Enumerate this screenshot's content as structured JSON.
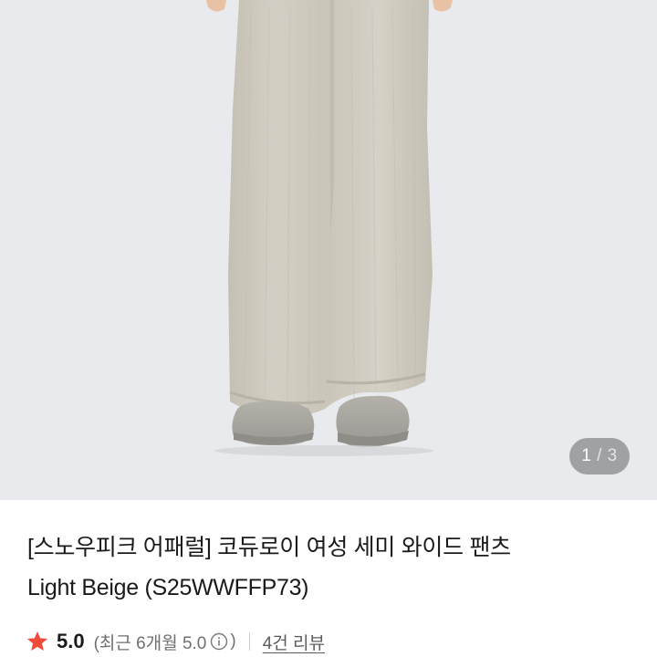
{
  "gallery": {
    "current": "1",
    "separator": "/",
    "total": "3"
  },
  "product": {
    "title_line1": "[스노우피크 어패럴] 코듀로이 여성 세미 와이드 팬츠",
    "title_line2": "Light Beige (S25WWFFP73)"
  },
  "rating": {
    "score": "5.0",
    "recent_open": "(최근 6개월 5.0",
    "recent_close": ")",
    "review_count": "4건 리뷰"
  },
  "icons": {
    "star": "star-icon",
    "info": "info-circle-icon"
  },
  "colors": {
    "star": "#f04a3a",
    "background_photo": "#e8eaed",
    "pants": "#cfcbbf",
    "shoes": "#a8a69f"
  }
}
